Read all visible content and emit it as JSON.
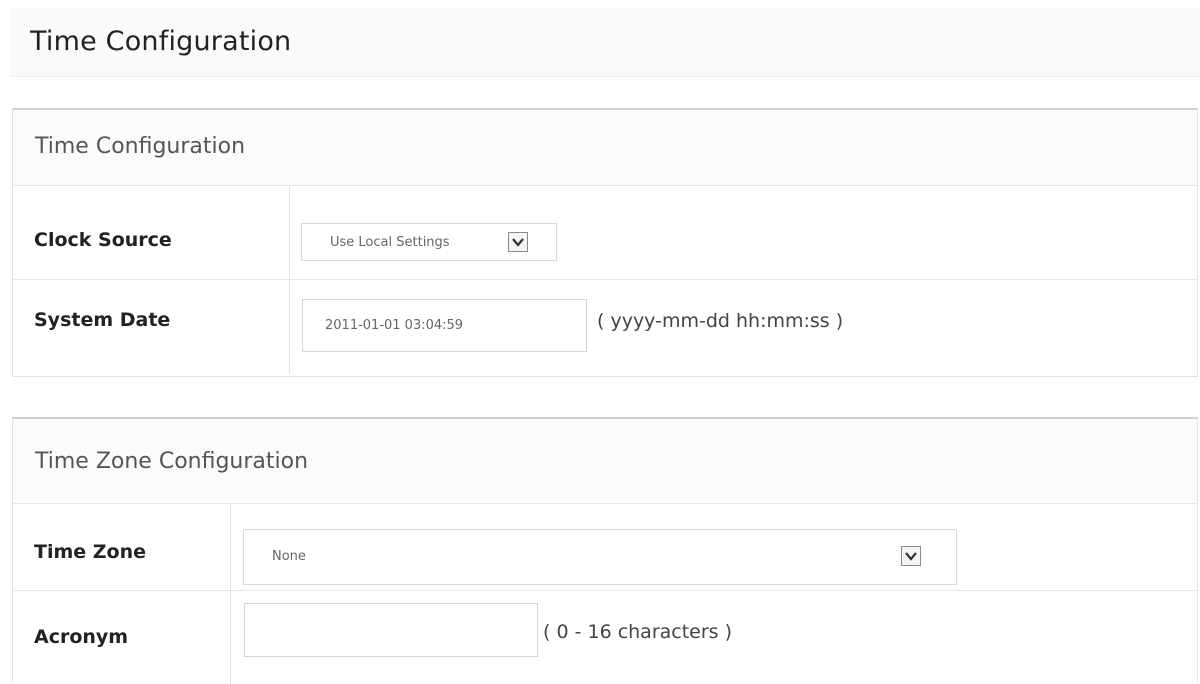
{
  "page": {
    "title": "Time Configuration"
  },
  "time_config": {
    "title": "Time Configuration",
    "clock_source": {
      "label": "Clock Source",
      "selected": "Use Local Settings"
    },
    "system_date": {
      "label": "System Date",
      "value": "2011-01-01 03:04:59",
      "hint": "( yyyy-mm-dd hh:mm:ss )"
    }
  },
  "tz_config": {
    "title": "Time Zone Configuration",
    "time_zone": {
      "label": "Time Zone",
      "selected": "None"
    },
    "acronym": {
      "label": "Acronym",
      "value": "",
      "hint": "( 0 - 16 characters )"
    }
  },
  "icons": {
    "dropdown": "chevron-down-icon"
  }
}
